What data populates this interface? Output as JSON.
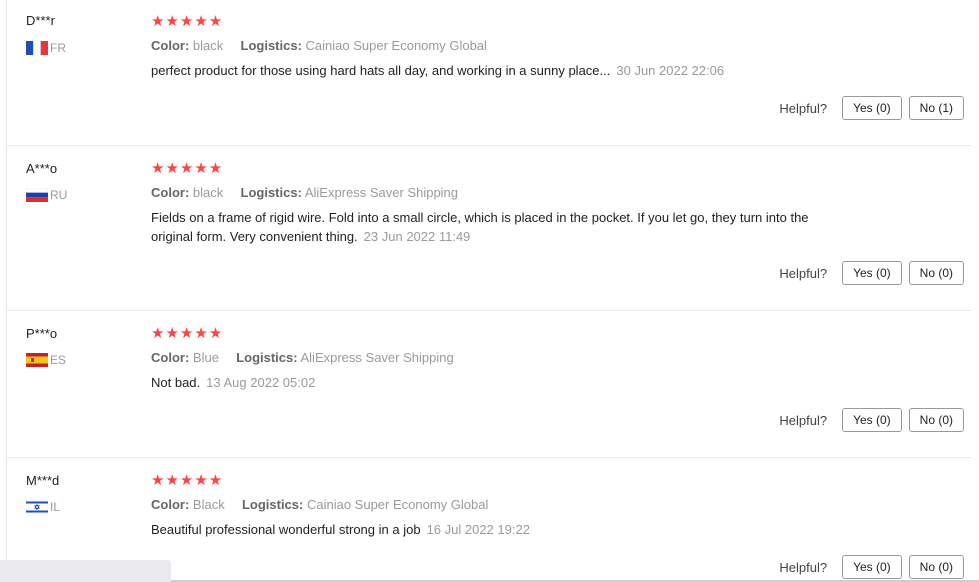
{
  "helpful_label": "Helpful?",
  "reviews": [
    {
      "user": "D***r",
      "country": "FR",
      "stars": "★★★★★",
      "color_key": "Color:",
      "color": "black",
      "logistics_key": "Logistics:",
      "logistics": "Cainiao Super Economy Global",
      "line1": "perfect product for those using hard hats all day, and working in a sunny place...",
      "line2": "",
      "date": "30 Jun 2022 22:06",
      "yes": "Yes (0)",
      "no": "No (1)"
    },
    {
      "user": "A***o",
      "country": "RU",
      "stars": "★★★★★",
      "color_key": "Color:",
      "color": "black",
      "logistics_key": "Logistics:",
      "logistics": "AliExpress Saver Shipping",
      "line1": "Fields on a frame of rigid wire. Fold into a small circle, which is placed in the pocket. If you let go, they turn into the",
      "line2": "original form. Very convenient thing.",
      "date": "23 Jun 2022 11:49",
      "yes": "Yes (0)",
      "no": "No (0)"
    },
    {
      "user": "P***o",
      "country": "ES",
      "stars": "★★★★★",
      "color_key": "Color:",
      "color": "Blue",
      "logistics_key": "Logistics:",
      "logistics": "AliExpress Saver Shipping",
      "line1": "Not bad.",
      "line2": "",
      "date": "13 Aug 2022 05:02",
      "yes": "Yes (0)",
      "no": "No (0)"
    },
    {
      "user": "M***d",
      "country": "IL",
      "stars": "★★★★★",
      "color_key": "Color:",
      "color": "Black",
      "logistics_key": "Logistics:",
      "logistics": "Cainiao Super Economy Global",
      "line1": "Beautiful professional wonderful strong in a job",
      "line2": "",
      "date": "16 Jul 2022 19:22",
      "yes": "Yes (0)",
      "no": "No (0)"
    }
  ]
}
